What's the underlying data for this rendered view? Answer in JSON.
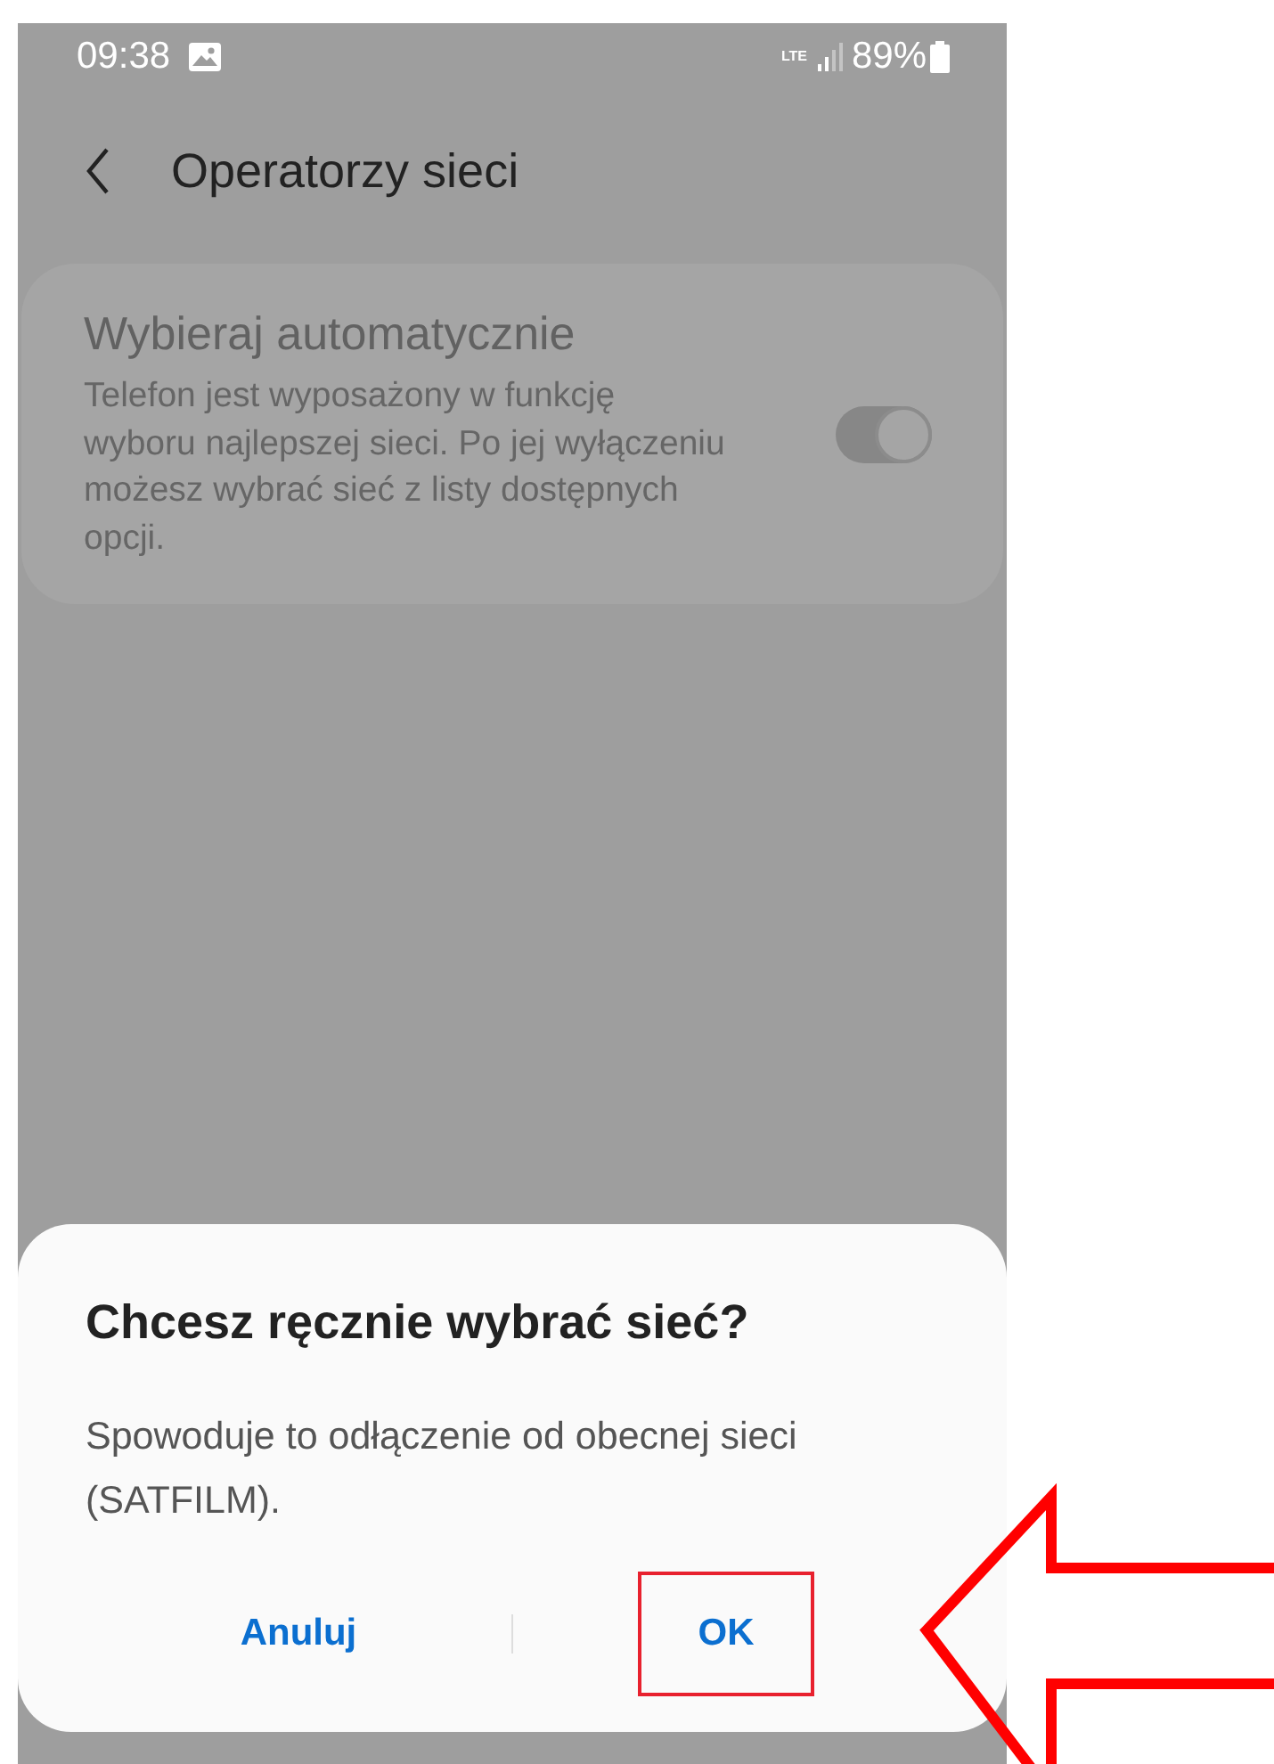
{
  "status_bar": {
    "time": "09:38",
    "network": "LTE",
    "battery": "89%"
  },
  "header": {
    "title": "Operatorzy sieci"
  },
  "setting": {
    "title": "Wybieraj automatycznie",
    "description": "Telefon jest wyposażony w funkcję wyboru najlepszej sieci. Po jej wyłączeniu możesz wybrać sieć z listy dostępnych opcji.",
    "on": true
  },
  "dialog": {
    "title": "Chcesz ręcznie wybrać sieć?",
    "message": "Spowoduje to odłączenie od obecnej sieci (SATFILM).",
    "buttons": [
      {
        "label": "Anuluj",
        "highlighted": false
      },
      {
        "label": "OK",
        "highlighted": true
      }
    ]
  }
}
